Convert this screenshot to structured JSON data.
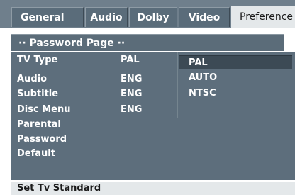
{
  "tabs": {
    "general": "General",
    "audio": "Audio",
    "dolby": "Dolby",
    "video": "Video",
    "preference": "Preference"
  },
  "page_title": "·· Password Page ··",
  "settings": [
    {
      "label": "TV Type",
      "value": "PAL"
    },
    {
      "label": "Audio",
      "value": "ENG"
    },
    {
      "label": "Subtitle",
      "value": "ENG"
    },
    {
      "label": "Disc Menu",
      "value": "ENG"
    },
    {
      "label": "Parental",
      "value": ""
    },
    {
      "label": "Password",
      "value": ""
    },
    {
      "label": "Default",
      "value": ""
    }
  ],
  "options": [
    {
      "label": "PAL",
      "selected": true
    },
    {
      "label": "AUTO",
      "selected": false
    },
    {
      "label": "NTSC",
      "selected": false
    }
  ],
  "status_text": "Set Tv Standard",
  "colors": {
    "panel": "#5d6e7c",
    "selected_option": "#3c4a55",
    "active_tab": "#e4e8ea"
  }
}
